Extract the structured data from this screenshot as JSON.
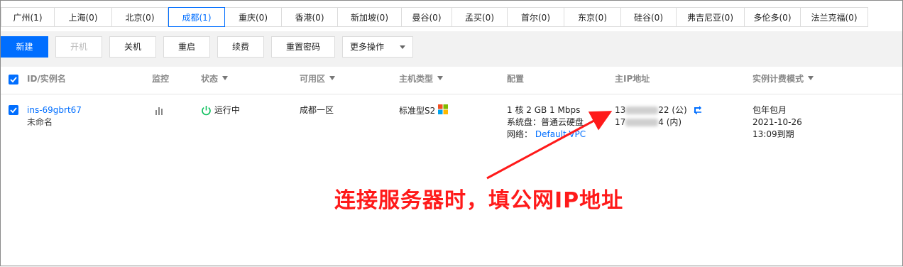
{
  "regions": [
    {
      "label": "广州(1)",
      "w": 76
    },
    {
      "label": "上海(0)",
      "w": 81
    },
    {
      "label": "北京(0)",
      "w": 79
    },
    {
      "label": "成都(1)",
      "w": 80,
      "active": true
    },
    {
      "label": "重庆(0)",
      "w": 80
    },
    {
      "label": "香港(0)",
      "w": 79
    },
    {
      "label": "新加坡(0)",
      "w": 90
    },
    {
      "label": "曼谷(0)",
      "w": 71
    },
    {
      "label": "孟买(0)",
      "w": 78
    },
    {
      "label": "首尔(0)",
      "w": 80
    },
    {
      "label": "东京(0)",
      "w": 80
    },
    {
      "label": "硅谷(0)",
      "w": 78
    },
    {
      "label": "弗吉尼亚(0)",
      "w": 96
    },
    {
      "label": "多伦多(0)",
      "w": 79
    },
    {
      "label": "法兰克福(0)",
      "w": 95
    }
  ],
  "toolbar": {
    "new_label": "新建",
    "power_on_label": "开机",
    "shutdown_label": "关机",
    "restart_label": "重启",
    "renew_label": "续费",
    "reset_password_label": "重置密码",
    "more_label": "更多操作"
  },
  "table": {
    "headers": {
      "id": "ID/实例名",
      "monitor": "监控",
      "status": "状态",
      "zone": "可用区",
      "type": "主机类型",
      "config": "配置",
      "ip": "主IP地址",
      "billing": "实例计费模式"
    },
    "row": {
      "instance_id": "ins-69gbrt67",
      "instance_name": "未命名",
      "status": "运行中",
      "zone": "成都一区",
      "type": "标准型S2",
      "config_line1": "1 核 2 GB 1 Mbps",
      "config_line2": "系统盘：普通云硬盘",
      "network_label": "网络：",
      "network_value": "Default-VPC",
      "public_ip_prefix": "13",
      "public_ip_suffix": "22 (公)",
      "private_ip_prefix": "17",
      "private_ip_suffix": "4 (内)",
      "billing_line1": "包年包月",
      "billing_line2": "2021-10-26",
      "billing_line3": "13:09到期"
    }
  },
  "annotation": {
    "text": "连接服务器时，填公网IP地址"
  },
  "colors": {
    "accent": "#006eff",
    "running": "#0abf5b",
    "annotation": "#ff1a1a"
  }
}
